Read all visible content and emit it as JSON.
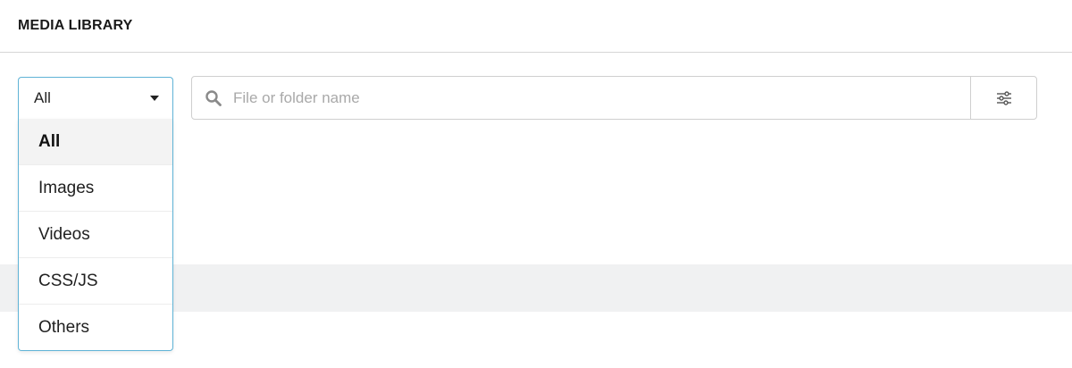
{
  "header": {
    "title": "MEDIA LIBRARY"
  },
  "type_filter": {
    "selected": "All",
    "options": [
      {
        "label": "All",
        "selected": true
      },
      {
        "label": "Images",
        "selected": false
      },
      {
        "label": "Videos",
        "selected": false
      },
      {
        "label": "CSS/JS",
        "selected": false
      },
      {
        "label": "Others",
        "selected": false
      }
    ]
  },
  "search": {
    "placeholder": "File or folder name",
    "value": "",
    "icon": "search-icon",
    "filter_icon": "sliders-icon"
  },
  "colors": {
    "dropdown_border": "#5fb3d6",
    "selected_row_bg": "#f3f3f3",
    "band_bg": "#f0f1f2"
  }
}
